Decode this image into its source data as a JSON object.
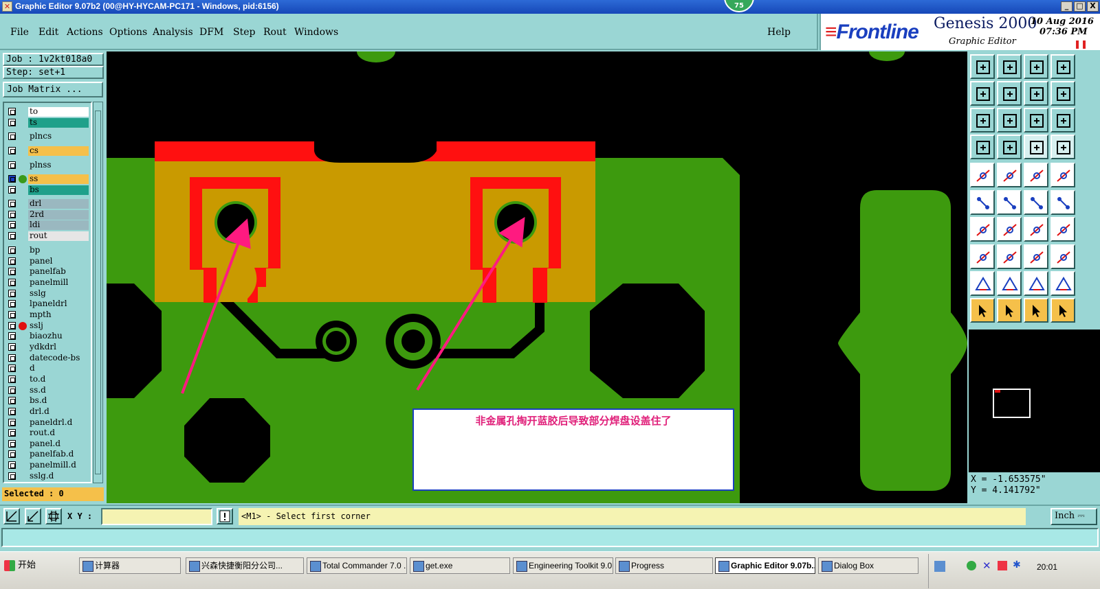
{
  "window": {
    "title": "Graphic Editor 9.07b2 (00@HY-HYCAM-PC171 - Windows, pid:6156)",
    "badge": "75",
    "minimize": "_",
    "maximize": "□",
    "close": "X"
  },
  "menu": {
    "items": [
      "File",
      "Edit",
      "Actions",
      "Options",
      "Analysis",
      "DFM",
      "Step",
      "Rout",
      "Windows"
    ],
    "help": "Help"
  },
  "brand": {
    "logo": "Frontline",
    "product": "Genesis 2000",
    "subtitle": "Graphic Editor",
    "date": "10 Aug 2016",
    "time": "07:36 PM"
  },
  "job": {
    "job_label": "Job : 1v2kt018a0",
    "step_label": "Step: set+1",
    "matrix_button": "Job Matrix ..."
  },
  "layers": [
    {
      "name": "to",
      "color": "#ffffff"
    },
    {
      "name": "ts",
      "color": "#1fa08a"
    },
    {
      "name": "plncs",
      "color": "#9ad6d4"
    },
    {
      "name": "cs",
      "color": "#f5c04a"
    },
    {
      "name": "plnss",
      "color": "#9ad6d4"
    },
    {
      "name": "ss",
      "color": "#f5c04a",
      "dot": "#3a9a1a",
      "active": true
    },
    {
      "name": "bs",
      "color": "#1fa08a"
    },
    {
      "name": "drl",
      "color": "#9ab8c0"
    },
    {
      "name": "2rd",
      "color": "#9ab8c0"
    },
    {
      "name": "ldi",
      "color": "#9ab8c0"
    },
    {
      "name": "rout",
      "color": "#e6e6e6"
    },
    {
      "name": "bp",
      "color": "#9ad6d4"
    },
    {
      "name": "panel",
      "color": "#9ad6d4"
    },
    {
      "name": "panelfab",
      "color": "#9ad6d4"
    },
    {
      "name": "panelmill",
      "color": "#9ad6d4"
    },
    {
      "name": "sslg",
      "color": "#9ad6d4"
    },
    {
      "name": "lpaneldrl",
      "color": "#9ad6d4"
    },
    {
      "name": "mpth",
      "color": "#9ad6d4"
    },
    {
      "name": "sslj",
      "color": "#9ad6d4",
      "dot": "#e01010"
    },
    {
      "name": "biaozhu",
      "color": "#9ad6d4"
    },
    {
      "name": "ydkdrl",
      "color": "#9ad6d4"
    },
    {
      "name": "datecode-bs",
      "color": "#9ad6d4"
    },
    {
      "name": "d",
      "color": "#9ad6d4"
    },
    {
      "name": "to.d",
      "color": "#9ad6d4"
    },
    {
      "name": "ss.d",
      "color": "#9ad6d4"
    },
    {
      "name": "bs.d",
      "color": "#9ad6d4"
    },
    {
      "name": "drl.d",
      "color": "#9ad6d4"
    },
    {
      "name": "paneldrl.d",
      "color": "#9ad6d4"
    },
    {
      "name": "rout.d",
      "color": "#9ad6d4"
    },
    {
      "name": "panel.d",
      "color": "#9ad6d4"
    },
    {
      "name": "panelfab.d",
      "color": "#9ad6d4"
    },
    {
      "name": "panelmill.d",
      "color": "#9ad6d4"
    },
    {
      "name": "sslg.d",
      "color": "#9ad6d4"
    }
  ],
  "selected": "Selected : 0",
  "annotation": "非金属孔掏开蓝胶后导致部分焊盘设盖住了",
  "coords": {
    "x": "X = -1.653575\"",
    "y": "Y = 4.141792\""
  },
  "bottom": {
    "xy_label": "X Y :",
    "xy_value": "",
    "message": "<M1> - Select first corner",
    "units": "Inch"
  },
  "taskbar": {
    "start": "开始",
    "tasks": [
      {
        "label": "计算器"
      },
      {
        "label": "兴森快捷衡阳分公司..."
      },
      {
        "label": "Total Commander 7.0 ..."
      },
      {
        "label": "get.exe"
      },
      {
        "label": "Engineering Toolkit 9.0..."
      },
      {
        "label": "Progress"
      },
      {
        "label": "Graphic Editor 9.07b...",
        "active": true
      },
      {
        "label": "Dialog Box"
      }
    ],
    "clock": "20:01"
  },
  "colors": {
    "copper": "#3d9a0e",
    "mask": "#c99a00",
    "pad": "#ff1010",
    "arrow": "#ff1a80"
  }
}
